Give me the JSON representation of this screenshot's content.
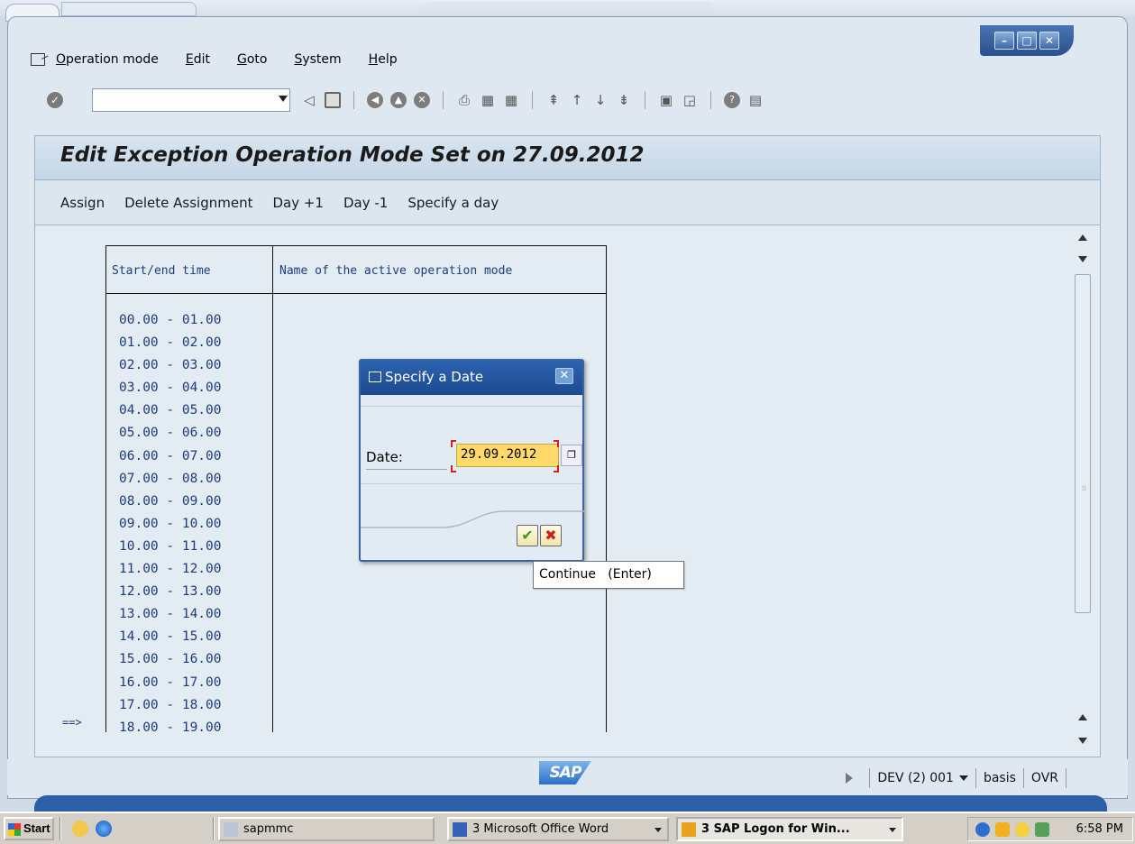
{
  "menubar": {
    "items": [
      "Operation mode",
      "Edit",
      "Goto",
      "System",
      "Help"
    ]
  },
  "window": {
    "title": "Edit Exception Operation Mode Set on 27.09.2012"
  },
  "app_toolbar": {
    "items": [
      "Assign",
      "Delete Assignment",
      "Day +1",
      "Day -1",
      "Specify a day"
    ]
  },
  "table": {
    "columns": [
      "Start/end time",
      "Name of the active operation mode"
    ],
    "rows": [
      "00.00 - 01.00",
      "01.00 - 02.00",
      "02.00 - 03.00",
      "03.00 - 04.00",
      "04.00 - 05.00",
      "05.00 - 06.00",
      "06.00 - 07.00",
      "07.00 - 08.00",
      "08.00 - 09.00",
      "09.00 - 10.00",
      "10.00 - 11.00",
      "11.00 - 12.00",
      "12.00 - 13.00",
      "13.00 - 14.00",
      "14.00 - 15.00",
      "15.00 - 16.00",
      "16.00 - 17.00",
      "17.00 - 18.00",
      "18.00 - 19.00"
    ],
    "current_marker": "==>"
  },
  "dialog": {
    "title": "Specify a Date",
    "date_label": "Date:",
    "date_value": "29.09.2012"
  },
  "tooltip": {
    "text": "Continue   (Enter)"
  },
  "statusbar": {
    "logo": "SAP",
    "system": "DEV (2) 001",
    "user": "basis",
    "mode": "OVR"
  },
  "taskbar": {
    "start_label": "Start",
    "tasks": [
      "sapmmc",
      "3 Microsoft Office Word",
      "3 SAP Logon for Win..."
    ],
    "clock": "6:58 PM"
  }
}
